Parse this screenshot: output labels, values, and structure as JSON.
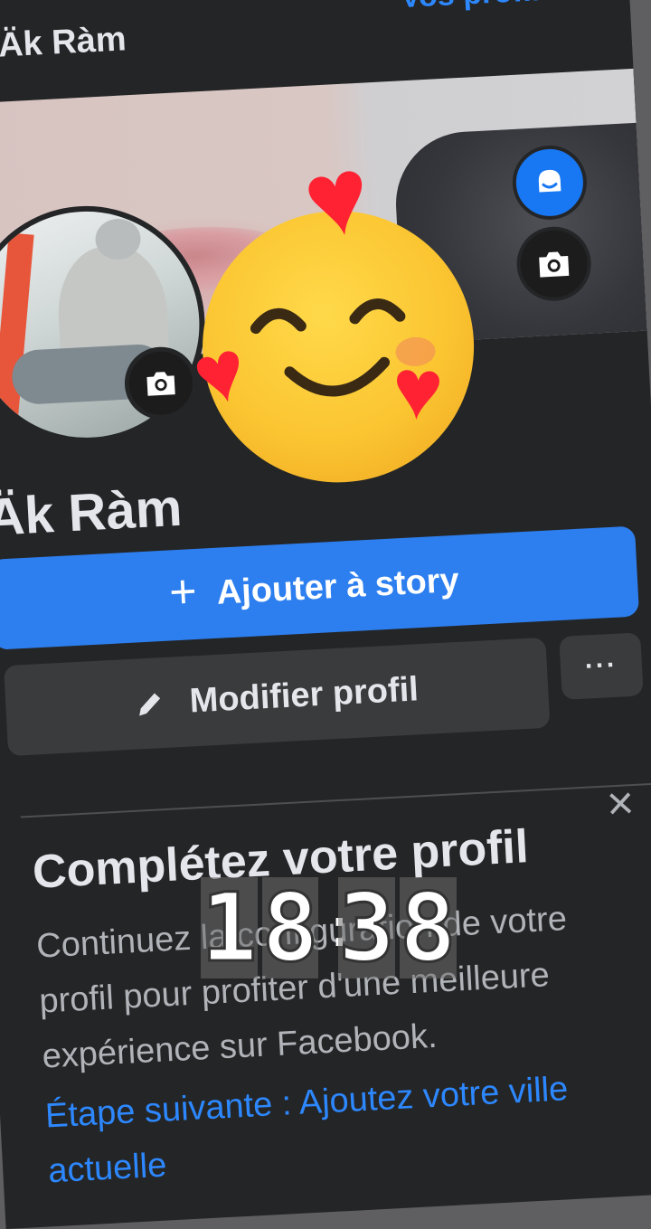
{
  "header": {
    "name": "Äk Ràm",
    "link_label": "Vos profils"
  },
  "profile": {
    "name": "Äk Ràm",
    "buttons": {
      "add_story": "Ajouter à story",
      "edit_profile": "Modifier profil",
      "more": "···"
    }
  },
  "complete_profile": {
    "title": "Complétez votre profil",
    "description": "Continuez la configuration de votre profil pour profiter d'une meilleure expérience sur Facebook.",
    "next_step": "Étape suivante : Ajoutez votre ville actuelle",
    "close": "×"
  },
  "overlay_clock": {
    "digits": [
      "1",
      "8",
      "3",
      "8"
    ],
    "separator": ":"
  },
  "colors": {
    "accent": "#2d7ff0",
    "background": "#242526",
    "heart": "#ff2233",
    "emoji": "#fbc531"
  }
}
